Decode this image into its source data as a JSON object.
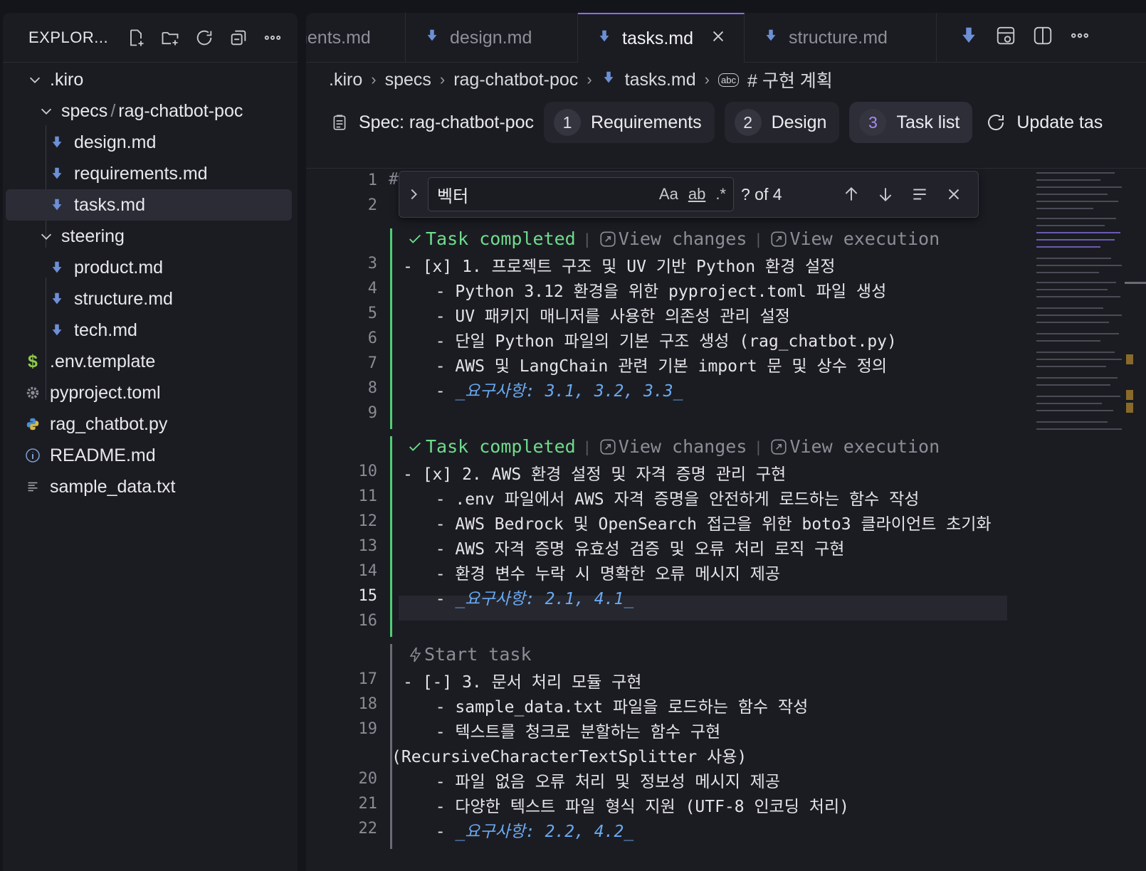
{
  "explorer": {
    "title": "EXPLOR...",
    "actions": [
      "new-file",
      "new-folder",
      "refresh",
      "collapse-all",
      "more"
    ],
    "tree": [
      {
        "label": ".kiro",
        "type": "folder",
        "open": true,
        "depth": 0
      },
      {
        "label": "specs",
        "label2": "rag-chatbot-poc",
        "type": "folder",
        "open": true,
        "depth": 1
      },
      {
        "label": "design.md",
        "type": "md",
        "depth": 2
      },
      {
        "label": "requirements.md",
        "type": "md",
        "depth": 2
      },
      {
        "label": "tasks.md",
        "type": "md",
        "depth": 2,
        "selected": true
      },
      {
        "label": "steering",
        "type": "folder",
        "open": true,
        "depth": 1
      },
      {
        "label": "product.md",
        "type": "md",
        "depth": 2
      },
      {
        "label": "structure.md",
        "type": "md",
        "depth": 2
      },
      {
        "label": "tech.md",
        "type": "md",
        "depth": 2
      },
      {
        "label": ".env.template",
        "type": "env",
        "depth": 0
      },
      {
        "label": "pyproject.toml",
        "type": "toml",
        "depth": 0
      },
      {
        "label": "rag_chatbot.py",
        "type": "py",
        "depth": 0
      },
      {
        "label": "README.md",
        "type": "info",
        "depth": 0
      },
      {
        "label": "sample_data.txt",
        "type": "txt",
        "depth": 0
      }
    ]
  },
  "tabs": [
    {
      "label": "nents.md",
      "active": false,
      "icon": false
    },
    {
      "label": "design.md",
      "active": false,
      "icon": true
    },
    {
      "label": "tasks.md",
      "active": true,
      "icon": true
    },
    {
      "label": "structure.md",
      "active": false,
      "icon": true
    }
  ],
  "breadcrumb": [
    ".kiro",
    "specs",
    "rag-chatbot-poc",
    "tasks.md",
    "# 구현 계획"
  ],
  "spec": {
    "label": "Spec: rag-chatbot-poc",
    "steps": [
      {
        "num": "1",
        "label": "Requirements"
      },
      {
        "num": "2",
        "label": "Design"
      },
      {
        "num": "3",
        "label": "Task list",
        "active": true
      }
    ],
    "update_label": "Update tas"
  },
  "find": {
    "value": "벡터",
    "count": "? of 4"
  },
  "codelens": {
    "done": "Task completed",
    "view_changes": "View changes",
    "view_execution": "View execution",
    "start": "Start task"
  },
  "gutter": [
    "1",
    "2",
    "3",
    "4",
    "5",
    "6",
    "7",
    "8",
    "9",
    "10",
    "11",
    "12",
    "13",
    "14",
    "15",
    "16",
    "17",
    "18",
    "19",
    "20",
    "21",
    "22"
  ],
  "current_line": "15",
  "lines": {
    "l1": "#",
    "l3": "- [x] 1. 프로젝트 구조 및 UV 기반 Python 환경 설정",
    "l4": "  - Python 3.12 환경을 위한 pyproject.toml 파일 생성",
    "l5": "  - UV 패키지 매니저를 사용한 의존성 관리 설정",
    "l6": "  - 단일 Python 파일의 기본 구조 생성 (rag_chatbot.py)",
    "l7": "  - AWS 및 LangChain 관련 기본 import 문 및 상수 정의",
    "l8": "_요구사항: 3.1, 3.2, 3.3_",
    "l10": "- [x] 2. AWS 환경 설정 및 자격 증명 관리 구현",
    "l11": "  - .env 파일에서 AWS 자격 증명을 안전하게 로드하는 함수 작성",
    "l12": "  - AWS Bedrock 및 OpenSearch 접근을 위한 boto3 클라이언트 초기화",
    "l13": "  - AWS 자격 증명 유효성 검증 및 오류 처리 로직 구현",
    "l14": "  - 환경 변수 누락 시 명확한 오류 메시지 제공",
    "l15": "_요구사항: 2.1, 4.1_",
    "l17": "- [-] 3. 문서 처리 모듈 구현",
    "l18": "  - sample_data.txt 파일을 로드하는 함수 작성",
    "l19": "  - 텍스트를 청크로 분할하는 함수 구현",
    "l19b": "(RecursiveCharacterTextSplitter 사용)",
    "l20": "  - 파일 없음 오류 처리 및 정보성 메시지 제공",
    "l21": "  - 다양한 텍스트 파일 형식 지원 (UTF-8 인코딩 처리)",
    "l22": "_요구사항: 2.2, 4.2_"
  },
  "colors": {
    "accent": "#8b6cf0",
    "completed": "#6fdc8c",
    "requirement": "#6aa9f0"
  }
}
